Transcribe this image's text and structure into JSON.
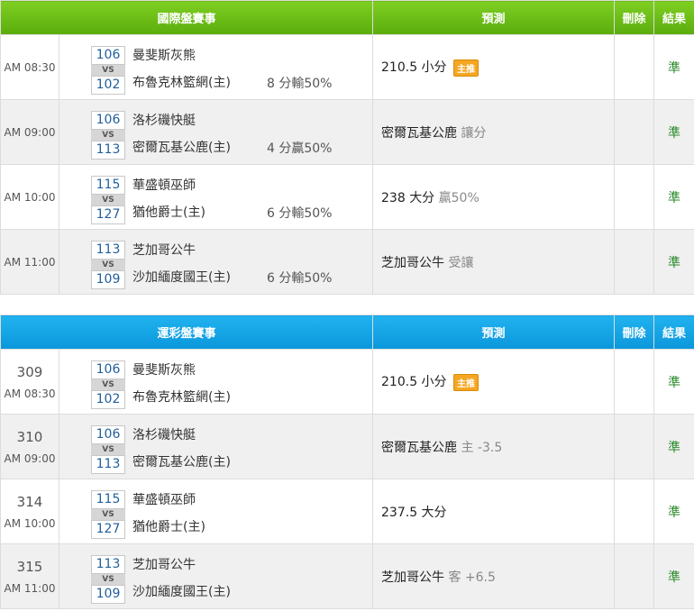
{
  "intl": {
    "header": {
      "match": "國際盤賽事",
      "pred": "預測",
      "del": "刪除",
      "result": "結果"
    },
    "rows": [
      {
        "no": "",
        "time": "AM 08:30",
        "s1": "106",
        "s2": "102",
        "vs": "VS",
        "t1": "曼斐斯灰熊",
        "t2": "布魯克林籃網(主)",
        "hcp": "8 分輸50%",
        "pred": "210.5 小分",
        "sub": "",
        "badge": "主推",
        "result": "準"
      },
      {
        "no": "",
        "time": "AM 09:00",
        "s1": "106",
        "s2": "113",
        "vs": "VS",
        "t1": "洛杉磯快艇",
        "t2": "密爾瓦基公鹿(主)",
        "hcp": "4 分贏50%",
        "pred": "密爾瓦基公鹿",
        "sub": "讓分",
        "badge": "",
        "result": "準"
      },
      {
        "no": "",
        "time": "AM 10:00",
        "s1": "115",
        "s2": "127",
        "vs": "VS",
        "t1": "華盛頓巫師",
        "t2": "猶他爵士(主)",
        "hcp": "6 分輸50%",
        "pred": "238 大分",
        "sub": "贏50%",
        "badge": "",
        "result": "準"
      },
      {
        "no": "",
        "time": "AM 11:00",
        "s1": "113",
        "s2": "109",
        "vs": "VS",
        "t1": "芝加哥公牛",
        "t2": "沙加緬度國王(主)",
        "hcp": "6 分輸50%",
        "pred": "芝加哥公牛",
        "sub": "受讓",
        "badge": "",
        "result": "準"
      }
    ]
  },
  "sport": {
    "header": {
      "match": "運彩盤賽事",
      "pred": "預測",
      "del": "刪除",
      "result": "結果"
    },
    "rows": [
      {
        "no": "309",
        "time": "AM 08:30",
        "s1": "106",
        "s2": "102",
        "vs": "VS",
        "t1": "曼斐斯灰熊",
        "t2": "布魯克林籃網(主)",
        "hcp": "",
        "pred": "210.5 小分",
        "sub": "",
        "badge": "主推",
        "result": "準"
      },
      {
        "no": "310",
        "time": "AM 09:00",
        "s1": "106",
        "s2": "113",
        "vs": "VS",
        "t1": "洛杉磯快艇",
        "t2": "密爾瓦基公鹿(主)",
        "hcp": "",
        "pred": "密爾瓦基公鹿",
        "sub": "主 -3.5",
        "badge": "",
        "result": "準"
      },
      {
        "no": "314",
        "time": "AM 10:00",
        "s1": "115",
        "s2": "127",
        "vs": "VS",
        "t1": "華盛頓巫師",
        "t2": "猶他爵士(主)",
        "hcp": "",
        "pred": "237.5 大分",
        "sub": "",
        "badge": "",
        "result": "準"
      },
      {
        "no": "315",
        "time": "AM 11:00",
        "s1": "113",
        "s2": "109",
        "vs": "VS",
        "t1": "芝加哥公牛",
        "t2": "沙加緬度國王(主)",
        "hcp": "",
        "pred": "芝加哥公牛",
        "sub": "客 +6.5",
        "badge": "",
        "result": "準"
      }
    ]
  }
}
